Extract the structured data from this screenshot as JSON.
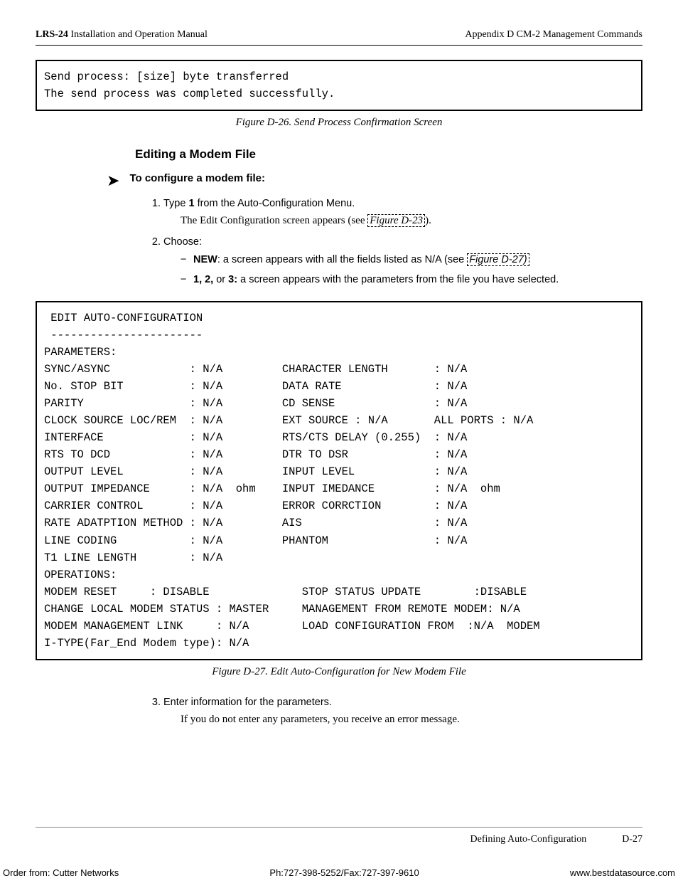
{
  "header": {
    "left_bold": "LRS-24",
    "left_rest": " Installation and Operation Manual",
    "right": "Appendix D  CM-2 Management Commands"
  },
  "box1": {
    "line1": "Send process: [size] byte transferred",
    "line2": "The send process was completed successfully."
  },
  "fig1_caption": "Figure D-26.  Send Process Confirmation Screen",
  "section_title": "Editing a Modem File",
  "subhead": "To  configure a modem file:",
  "step1_a": "Type ",
  "step1_b": "1",
  "step1_c": " from the Auto-Configuration Menu.",
  "step1_indent_a": "The Edit Configuration screen appears (see ",
  "step1_link": "Figure D-23",
  "step1_indent_b": ").",
  "step2": "Choose:",
  "step2_new_b": "NEW",
  "step2_new_rest": ": a screen appears with all the fields listed as N/A (see ",
  "step2_new_link": "Figure D-27)",
  "step2_123_b": "1, 2,",
  "step2_123_or": " or ",
  "step2_123_b2": "3:",
  "step2_123_rest": " a screen appears with the parameters from the file you have selected.",
  "box2": " EDIT AUTO-CONFIGURATION\n -----------------------\nPARAMETERS:\nSYNC/ASYNC            : N/A         CHARACTER LENGTH       : N/A\nNo. STOP BIT          : N/A         DATA RATE              : N/A\nPARITY                : N/A         CD SENSE               : N/A\nCLOCK SOURCE LOC/REM  : N/A         EXT SOURCE : N/A       ALL PORTS : N/A\nINTERFACE             : N/A         RTS/CTS DELAY (0.255)  : N/A\nRTS TO DCD            : N/A         DTR TO DSR             : N/A\nOUTPUT LEVEL          : N/A         INPUT LEVEL            : N/A\nOUTPUT IMPEDANCE      : N/A  ohm    INPUT IMEDANCE         : N/A  ohm\nCARRIER CONTROL       : N/A         ERROR CORRCTION        : N/A\nRATE ADATPTION METHOD : N/A         AIS                    : N/A\nLINE CODING           : N/A         PHANTOM                : N/A\nT1 LINE LENGTH        : N/A\nOPERATIONS:\nMODEM RESET     : DISABLE              STOP STATUS UPDATE        :DISABLE\nCHANGE LOCAL MODEM STATUS : MASTER     MANAGEMENT FROM REMOTE MODEM: N/A\nMODEM MANAGEMENT LINK     : N/A        LOAD CONFIGURATION FROM  :N/A  MODEM\nI-TYPE(Far_End Modem type): N/A",
  "fig2_caption": "Figure D-27.  Edit Auto-Configuration for New Modem File",
  "step3": "Enter information for the parameters.",
  "step3_indent": "If you do not enter any parameters, you receive an error message.",
  "footer": {
    "label": "Defining Auto-Configuration",
    "page": "D-27"
  },
  "order": {
    "left": "Order from: Cutter Networks",
    "mid": "Ph:727-398-5252/Fax:727-397-9610",
    "right": "www.bestdatasource.com"
  }
}
